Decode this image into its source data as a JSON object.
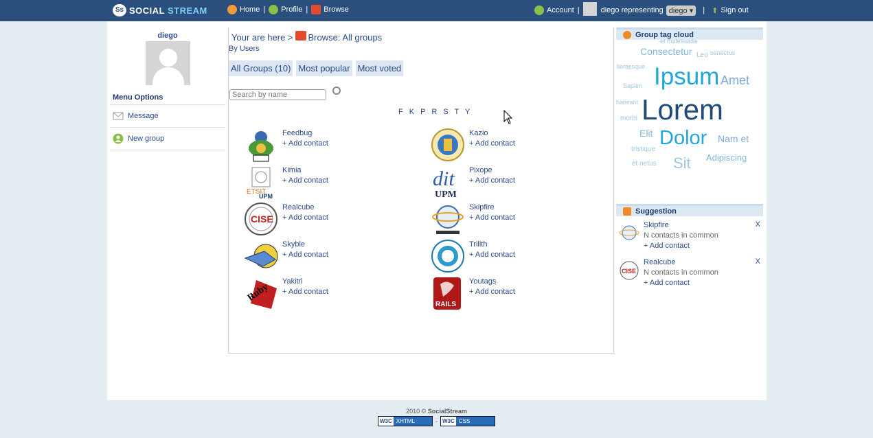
{
  "topbar": {
    "logo_mark": "Ss",
    "logo_social": "SOCIAL ",
    "logo_stream": "STREAM",
    "home": "Home",
    "profile": "Profile",
    "browse": "Browse",
    "account": "Account",
    "user_text": "diego representing",
    "representing_value": "diego",
    "signout": "Sign out"
  },
  "left": {
    "username": "diego",
    "menu_header": "Menu Options",
    "items": [
      {
        "label": "Message",
        "icon": "envelope-icon"
      },
      {
        "label": "New group",
        "icon": "group-icon"
      }
    ]
  },
  "main": {
    "crumb_prefix": "Your are here >",
    "crumb_label": "Browse: All groups",
    "by_users": "By Users",
    "tabs": [
      "All Groups (10)",
      "Most popular",
      "Most voted"
    ],
    "search_placeholder": "Search by name",
    "letters": "F K P R S T Y",
    "add_contact": "+ Add contact",
    "groups": [
      {
        "name": "Feedbug"
      },
      {
        "name": "Kazio"
      },
      {
        "name": "Kimia"
      },
      {
        "name": "Pixope"
      },
      {
        "name": "Realcube"
      },
      {
        "name": "Skipfire"
      },
      {
        "name": "Skyble"
      },
      {
        "name": "Trilith"
      },
      {
        "name": "Yakitri"
      },
      {
        "name": "Youtags"
      }
    ],
    "logo_texts": {
      "etsit": "ETSIT",
      "upm": "UPM",
      "dit": "dit",
      "cise": "CISE",
      "ruby": "Ruby",
      "rails": "RAILS"
    }
  },
  "right": {
    "cloud_header": "Group tag cloud",
    "cloud": [
      {
        "t": "et malesuada"
      },
      {
        "t": "Consectetur"
      },
      {
        "t": "Leo"
      },
      {
        "t": "senectus"
      },
      {
        "t": "llentesque"
      },
      {
        "t": "Ipsum"
      },
      {
        "t": "Amet"
      },
      {
        "t": "Sapien"
      },
      {
        "t": "habitant"
      },
      {
        "t": "Lorem"
      },
      {
        "t": "morbi"
      },
      {
        "t": "Elit"
      },
      {
        "t": "Dolor"
      },
      {
        "t": "Nam et"
      },
      {
        "t": "tristique"
      },
      {
        "t": "Sit"
      },
      {
        "t": "Adipiscing"
      },
      {
        "t": "et netus"
      }
    ],
    "suggestion_header": "Suggestion",
    "suggestions": [
      {
        "name": "Skipfire",
        "common": "N contacts in common",
        "add": "+ Add contact",
        "close": "X"
      },
      {
        "name": "Realcube",
        "common": "N contacts in common",
        "add": "+ Add contact",
        "close": "X"
      }
    ]
  },
  "footer": {
    "year": "2010 ©",
    "brand": "SocialStream",
    "xhtml": "XHTML",
    "css": "CSS",
    "w3c": "W3C",
    "separator": "-"
  },
  "colors": {
    "topbar": "#2a4f7c",
    "accent": "#1fa8d6",
    "link": "#2a4a8a"
  }
}
